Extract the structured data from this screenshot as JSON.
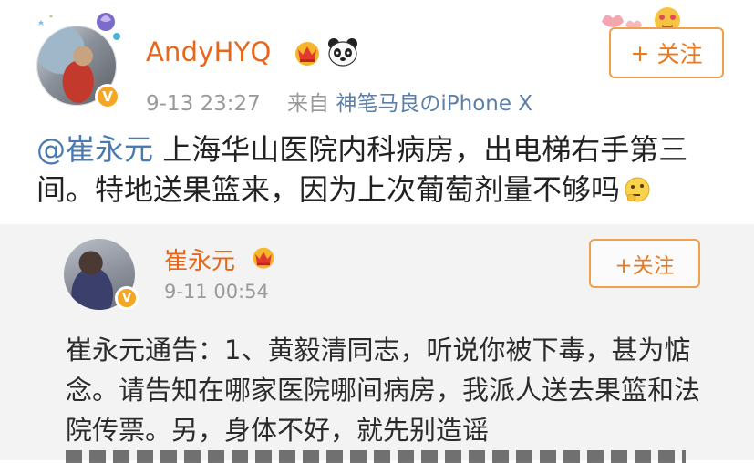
{
  "post": {
    "username": "AndyHYQ",
    "time": "9-13 23:27",
    "source_prefix": "来自",
    "source": "神笔马良のiPhone X",
    "follow_label": "关注",
    "follow_plus": "+",
    "mention": "@崔永元",
    "text": " 上海华山医院内科病房，出电梯右手第三间。特地送果篮来，因为上次葡萄剂量不够吗"
  },
  "repost": {
    "username": "崔永元",
    "time": "9-11 00:54",
    "follow_label": "+关注",
    "text": "崔永元通告：1、黄毅清同志，听说你被下毒，甚为惦念。请告知在哪家医院哪间病房，我派人送去果篮和法院传票。另，身体不好，就先别造谣"
  },
  "icons": {
    "verified": "verified-v-badge",
    "crown": "crown-icon",
    "panda": "panda-icon",
    "thinking": "thinking-emoji"
  },
  "colors": {
    "username": "#e8661b",
    "link": "#4a7ab0",
    "follow_border": "#f0a04b",
    "meta": "#9a9a9a",
    "repost_bg": "#f3f3f3"
  }
}
